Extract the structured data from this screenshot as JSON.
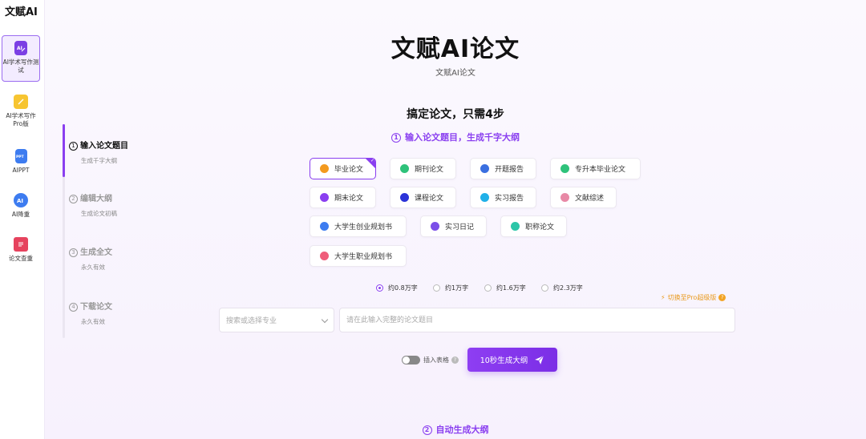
{
  "app": {
    "logo": "文赋AI"
  },
  "sidebar": {
    "items": [
      {
        "label": "AI学术写作测试",
        "icon": "ai-pen-icon",
        "color": "#7b3fe4",
        "active": true
      },
      {
        "label": "AI学术写作Pro版",
        "icon": "notepad-icon",
        "color": "#f7c531",
        "active": false
      },
      {
        "label": "AIPPT",
        "icon": "ppt-icon",
        "color": "#3d7cf0",
        "active": false
      },
      {
        "label": "AI降重",
        "icon": "ai-badge-icon",
        "color": "#3d7cf0",
        "active": false
      },
      {
        "label": "论文查重",
        "icon": "document-check-icon",
        "color": "#e6435e",
        "active": false
      }
    ]
  },
  "header": {
    "title": "文赋AI论文",
    "subtitle": "文赋AI论文",
    "headline": "搞定论文，只需4步"
  },
  "steps": [
    {
      "num": "1",
      "title": "输入论文题目",
      "desc": "生成千字大纲",
      "active": true
    },
    {
      "num": "2",
      "title": "编辑大纲",
      "desc": "生成论文初稿",
      "active": false
    },
    {
      "num": "3",
      "title": "生成全文",
      "desc": "永久有效",
      "active": false
    },
    {
      "num": "4",
      "title": "下载论文",
      "desc": "永久有效",
      "active": false
    }
  ],
  "step_headers": {
    "first": {
      "num": "1",
      "label": "输入论文题目，生成千字大纲"
    },
    "second": {
      "num": "2",
      "label": "自动生成大纲"
    }
  },
  "paper_types": [
    {
      "label": "毕业论文",
      "color": "#f39a1e",
      "selected": true
    },
    {
      "label": "期刊论文",
      "color": "#2ec27a",
      "selected": false
    },
    {
      "label": "开题报告",
      "color": "#3a6fe0",
      "selected": false
    },
    {
      "label": "专升本毕业论文",
      "color": "#2ec27a",
      "selected": false
    },
    {
      "label": "期末论文",
      "color": "#8a3ff0",
      "selected": false
    },
    {
      "label": "课程论文",
      "color": "#2b33d8",
      "selected": false
    },
    {
      "label": "实习报告",
      "color": "#20b0e8",
      "selected": false
    },
    {
      "label": "文献综述",
      "color": "#e889a6",
      "selected": false
    },
    {
      "label": "大学生创业规划书",
      "color": "#3d7cf0",
      "selected": false
    },
    {
      "label": "实习日记",
      "color": "#7b4fe8",
      "selected": false
    },
    {
      "label": "职称论文",
      "color": "#2cc6a8",
      "selected": false
    },
    {
      "label": "大学生职业规划书",
      "color": "#ef5d7a",
      "selected": false
    }
  ],
  "word_counts": [
    {
      "label": "约0.8万字",
      "checked": true
    },
    {
      "label": "约1万字",
      "checked": false
    },
    {
      "label": "约1.6万字",
      "checked": false
    },
    {
      "label": "约2.3万字",
      "checked": false
    }
  ],
  "pro_link": {
    "label": "切换至Pro超级版",
    "icon": "lightning-icon"
  },
  "form": {
    "major_placeholder": "搜索或选择专业",
    "title_placeholder": "请在此输入完整的论文题目",
    "title_value": ""
  },
  "options": {
    "insert_table_label": "插入表格",
    "insert_table_on": false
  },
  "generate": {
    "label": "10秒生成大纲",
    "icon": "paper-plane-icon"
  },
  "colors": {
    "accent": "#8a3ff0",
    "pro": "#e99a1d"
  }
}
